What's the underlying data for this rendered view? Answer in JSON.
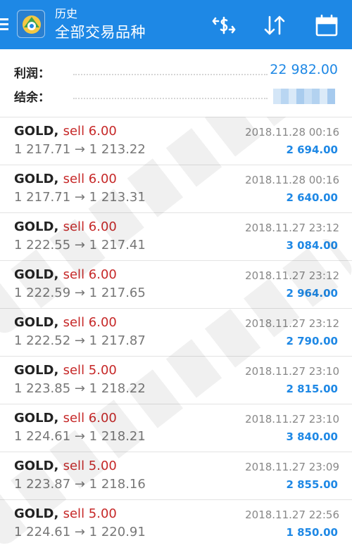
{
  "header": {
    "subtitle": "历史",
    "title": "全部交易品种",
    "icons": [
      "menu-icon",
      "app-logo-icon",
      "currency-swap-icon",
      "sort-icon",
      "calendar-icon"
    ],
    "color": "#1e88e5"
  },
  "summary": {
    "profit_label": "利润：",
    "profit_value": "22 982.00",
    "balance_label": "结余："
  },
  "trades": [
    {
      "symbol": "GOLD,",
      "side": "sell 6.00",
      "prices": "1 217.71 → 1 213.22",
      "time": "2018.11.28 00:16",
      "profit": "2 694.00"
    },
    {
      "symbol": "GOLD,",
      "side": "sell 6.00",
      "prices": "1 217.71 → 1 213.31",
      "time": "2018.11.28 00:16",
      "profit": "2 640.00"
    },
    {
      "symbol": "GOLD,",
      "side": "sell 6.00",
      "prices": "1 222.55 → 1 217.41",
      "time": "2018.11.27 23:12",
      "profit": "3 084.00"
    },
    {
      "symbol": "GOLD,",
      "side": "sell 6.00",
      "prices": "1 222.59 → 1 217.65",
      "time": "2018.11.27 23:12",
      "profit": "2 964.00"
    },
    {
      "symbol": "GOLD,",
      "side": "sell 6.00",
      "prices": "1 222.52 → 1 217.87",
      "time": "2018.11.27 23:12",
      "profit": "2 790.00"
    },
    {
      "symbol": "GOLD,",
      "side": "sell 5.00",
      "prices": "1 223.85 → 1 218.22",
      "time": "2018.11.27 23:10",
      "profit": "2 815.00"
    },
    {
      "symbol": "GOLD,",
      "side": "sell 6.00",
      "prices": "1 224.61 → 1 218.21",
      "time": "2018.11.27 23:10",
      "profit": "3 840.00"
    },
    {
      "symbol": "GOLD,",
      "side": "sell 5.00",
      "prices": "1 223.87 → 1 218.16",
      "time": "2018.11.27 23:09",
      "profit": "2 855.00"
    },
    {
      "symbol": "GOLD,",
      "side": "sell 5.00",
      "prices": "1 224.61 → 1 220.91",
      "time": "2018.11.27 22:56",
      "profit": "1 850.00"
    }
  ]
}
